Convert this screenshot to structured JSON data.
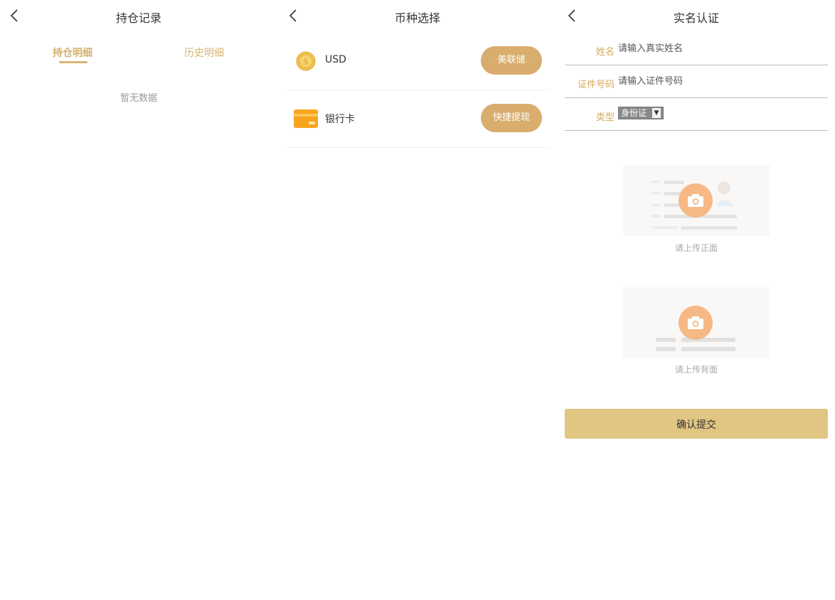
{
  "holdings": {
    "title": "持仓记录",
    "tabs": [
      {
        "label": "持仓明细",
        "active": true
      },
      {
        "label": "历史明细",
        "active": false
      }
    ],
    "empty_text": "暂无数据"
  },
  "currency": {
    "title": "币种选择",
    "items": [
      {
        "icon": "coin-icon",
        "label": "USD",
        "action": "美联储"
      },
      {
        "icon": "bank-card-icon",
        "label": "银行卡",
        "action": "快捷提现"
      }
    ]
  },
  "verify": {
    "title": "实名认证",
    "fields": {
      "name": {
        "label": "姓名",
        "placeholder": "请输入真实姓名",
        "value": ""
      },
      "id_number": {
        "label": "证件号码",
        "placeholder": "请输入证件号码",
        "value": ""
      },
      "type": {
        "label": "类型",
        "selected": "身份证"
      }
    },
    "uploads": {
      "front_label": "请上传正面",
      "back_label": "请上传背面"
    },
    "submit_label": "确认提交"
  },
  "colors": {
    "accent": "#d9ad6d",
    "gold_text": "#d6a85d",
    "submit_bg": "#e0c583",
    "camera": "#f6b681"
  }
}
